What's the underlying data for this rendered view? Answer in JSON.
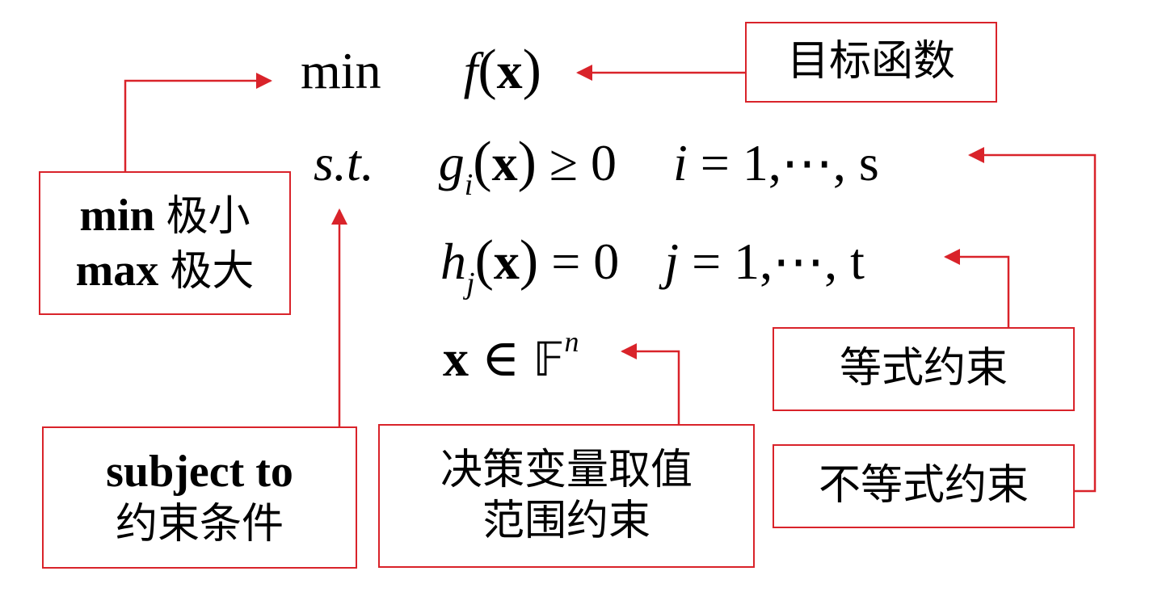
{
  "formula": {
    "objective": {
      "op": "min",
      "func": "f",
      "arg": "x"
    },
    "st_label": "s.t.",
    "inequality": {
      "func": "g",
      "sub": "i",
      "arg": "x",
      "rel": "≥ 0",
      "idx": "i",
      "range": "= 1,⋯, s"
    },
    "equality": {
      "func": "h",
      "sub": "j",
      "arg": "x",
      "rel": "= 0",
      "idx": "j",
      "range": "= 1,⋯, t"
    },
    "domain": {
      "var": "x",
      "rel": "∈",
      "set": "𝔽",
      "sup": "n"
    }
  },
  "annotations": {
    "objective_label": "目标函数",
    "minmax": {
      "min_en": "min",
      "min_zh": "极小",
      "max_en": "max",
      "max_zh": "极大"
    },
    "subject_to": {
      "en": "subject to",
      "zh": "约束条件"
    },
    "domain_label": {
      "line1": "决策变量取值",
      "line2": "范围约束"
    },
    "equality_label": "等式约束",
    "inequality_label": "不等式约束"
  },
  "colors": {
    "accent": "#d9232a"
  }
}
